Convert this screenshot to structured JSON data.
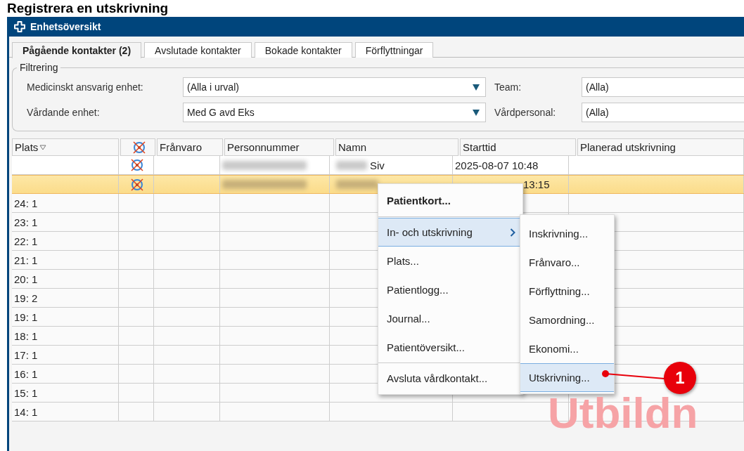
{
  "heading": "Registrera en utskrivning",
  "window": {
    "title": "Enhetsöversikt"
  },
  "tabs": [
    {
      "label": "Pågående kontakter (2)",
      "selected": true
    },
    {
      "label": "Avslutade kontakter",
      "selected": false
    },
    {
      "label": "Bokade kontakter",
      "selected": false
    },
    {
      "label": "Förflyttningar",
      "selected": false
    }
  ],
  "filter": {
    "legend": "Filtrering",
    "fields": [
      {
        "label": "Medicinskt ansvarig enhet:",
        "value": "(Alla i urval)",
        "kind": "dropdown"
      },
      {
        "label": "Team:",
        "value": "(Alla)",
        "kind": "field"
      },
      {
        "label": "Vårdande enhet:",
        "value": "Med G avd Eks",
        "kind": "dropdown"
      },
      {
        "label": "Vårdpersonal:",
        "value": "(Alla)",
        "kind": "field"
      }
    ]
  },
  "table": {
    "columns": [
      {
        "label": "Plats",
        "kind": "sortable"
      },
      {
        "kind": "icon"
      },
      {
        "label": "Frånvaro",
        "kind": "text"
      },
      {
        "label": "Personnummer",
        "kind": "text"
      },
      {
        "label": "Namn",
        "kind": "text"
      },
      {
        "label": "Starttid",
        "kind": "text"
      },
      {
        "label": "Planerad utskrivning",
        "kind": "text"
      }
    ],
    "rows": [
      {
        "kind": "patient",
        "selected": false,
        "name": "Siv",
        "start": "2025-08-07 10:48"
      },
      {
        "kind": "patient",
        "selected": true,
        "start": "13:15"
      },
      {
        "kind": "vacant",
        "selected": false,
        "plats": "24: 1"
      },
      {
        "kind": "vacant",
        "selected": false,
        "plats": "23: 1"
      },
      {
        "kind": "vacant",
        "selected": false,
        "plats": "22: 1"
      },
      {
        "kind": "vacant",
        "selected": false,
        "plats": "21: 1"
      },
      {
        "kind": "vacant",
        "selected": false,
        "plats": "20: 1"
      },
      {
        "kind": "vacant",
        "selected": false,
        "plats": "19: 2"
      },
      {
        "kind": "vacant",
        "selected": false,
        "plats": "19: 1"
      },
      {
        "kind": "vacant",
        "selected": false,
        "plats": "18: 1"
      },
      {
        "kind": "vacant",
        "selected": false,
        "plats": "17: 1"
      },
      {
        "kind": "vacant",
        "selected": false,
        "plats": "16: 1"
      },
      {
        "kind": "vacant",
        "selected": false,
        "plats": "15: 1"
      },
      {
        "kind": "vacant",
        "selected": false,
        "plats": "14: 1"
      }
    ]
  },
  "context_menu": {
    "items": [
      {
        "kind": "item",
        "label": "Patientkort...",
        "default": true,
        "selected": false
      },
      {
        "kind": "separator"
      },
      {
        "kind": "submenu",
        "label": "In- och utskrivning",
        "default": false,
        "selected": true
      },
      {
        "kind": "item",
        "label": "Plats...",
        "default": false,
        "selected": false
      },
      {
        "kind": "item",
        "label": "Patientlogg...",
        "default": false,
        "selected": false
      },
      {
        "kind": "item",
        "label": "Journal...",
        "default": false,
        "selected": false
      },
      {
        "kind": "item",
        "label": "Patientöversikt...",
        "default": false,
        "selected": false
      },
      {
        "kind": "separator"
      },
      {
        "kind": "item",
        "label": "Avsluta vårdkontakt...",
        "default": false,
        "selected": false
      }
    ]
  },
  "submenu": {
    "items": [
      {
        "label": "Inskrivning...",
        "selected": false
      },
      {
        "label": "Frånvaro...",
        "selected": false
      },
      {
        "label": "Förflyttning...",
        "selected": false
      },
      {
        "label": "Samordning...",
        "selected": false
      },
      {
        "label": "Ekonomi...",
        "selected": false
      },
      {
        "label": "Utskrivning...",
        "selected": true
      }
    ]
  },
  "callout": {
    "label": "1"
  },
  "watermark": "Utbildn"
}
